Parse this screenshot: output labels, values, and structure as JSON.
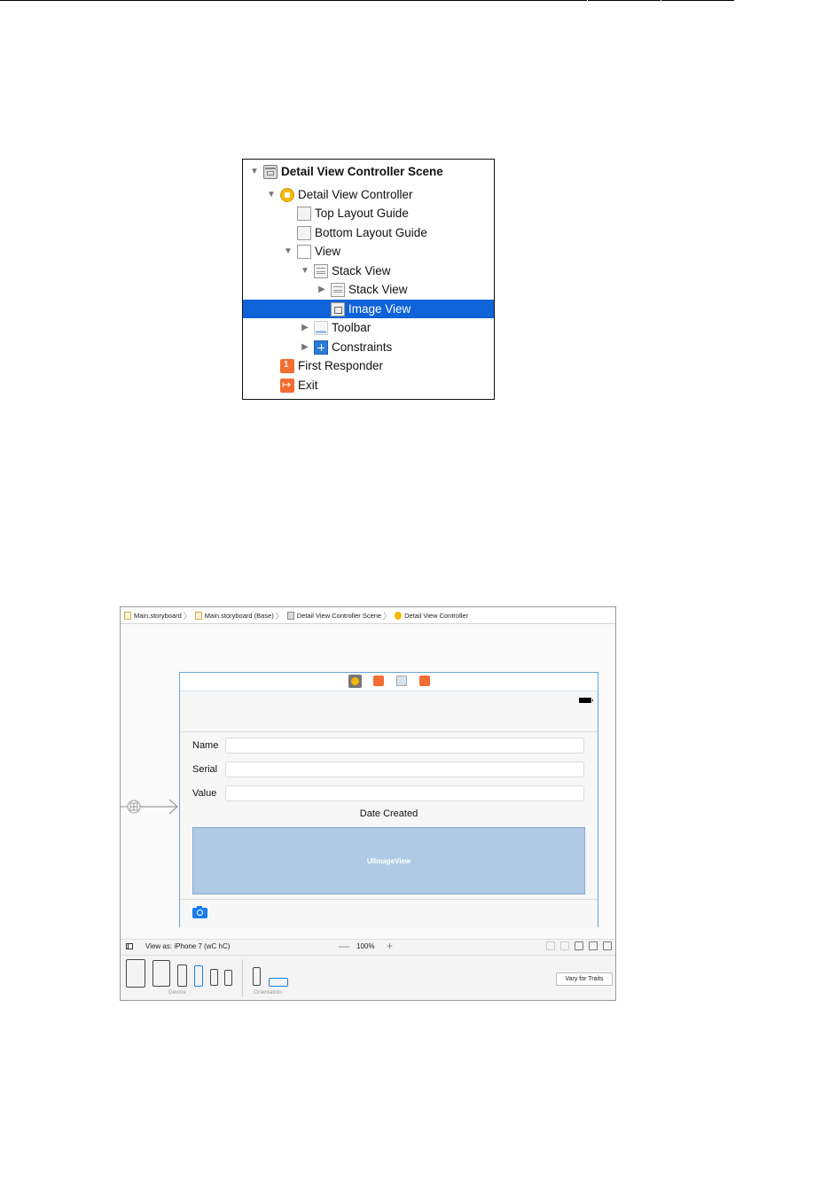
{
  "outline": {
    "rows": [
      {
        "label": "Detail View Controller Scene",
        "icon": "scene-icon",
        "disclosure": "expanded"
      },
      {
        "label": "Detail View Controller",
        "icon": "view-controller-icon",
        "disclosure": "expanded"
      },
      {
        "label": "Top Layout Guide",
        "icon": "layout-guide-icon",
        "disclosure": "none"
      },
      {
        "label": "Bottom Layout Guide",
        "icon": "layout-guide-icon",
        "disclosure": "none"
      },
      {
        "label": "View",
        "icon": "view-icon",
        "disclosure": "expanded"
      },
      {
        "label": "Stack View",
        "icon": "stack-view-icon",
        "disclosure": "expanded"
      },
      {
        "label": "Stack View",
        "icon": "stack-view-icon",
        "disclosure": "collapsed"
      },
      {
        "label": "Image View",
        "icon": "image-view-icon",
        "disclosure": "none",
        "selected": true
      },
      {
        "label": "Toolbar",
        "icon": "toolbar-icon",
        "disclosure": "collapsed"
      },
      {
        "label": "Constraints",
        "icon": "constraints-icon",
        "disclosure": "collapsed"
      },
      {
        "label": "First Responder",
        "icon": "first-responder-icon",
        "disclosure": "none"
      },
      {
        "label": "Exit",
        "icon": "exit-icon",
        "disclosure": "none"
      }
    ],
    "selection_color": "#0f63d8"
  },
  "jumpbar": {
    "items": [
      {
        "label": "Main.storyboard",
        "icon": "storyboard-file-icon"
      },
      {
        "label": "Main.storyboard (Base)",
        "icon": "storyboard-file-icon"
      },
      {
        "label": "Detail View Controller Scene",
        "icon": "scene-icon"
      },
      {
        "label": "Detail View Controller",
        "icon": "view-controller-icon"
      }
    ]
  },
  "scene": {
    "fields": [
      {
        "label": "Name",
        "value": ""
      },
      {
        "label": "Serial",
        "value": ""
      },
      {
        "label": "Value",
        "value": ""
      }
    ],
    "date_label": "Date Created",
    "image_view_label": "UIImageView",
    "image_view_color": "#b0cae6"
  },
  "bottom_bar": {
    "view_as": "View as: iPhone 7 (wC hC)",
    "zoom_minus": "—",
    "zoom": "100%",
    "zoom_plus": "+"
  },
  "device_bar": {
    "device_label": "Device",
    "orientation_label": "Orientation",
    "vary_button": "Vary for Traits"
  }
}
